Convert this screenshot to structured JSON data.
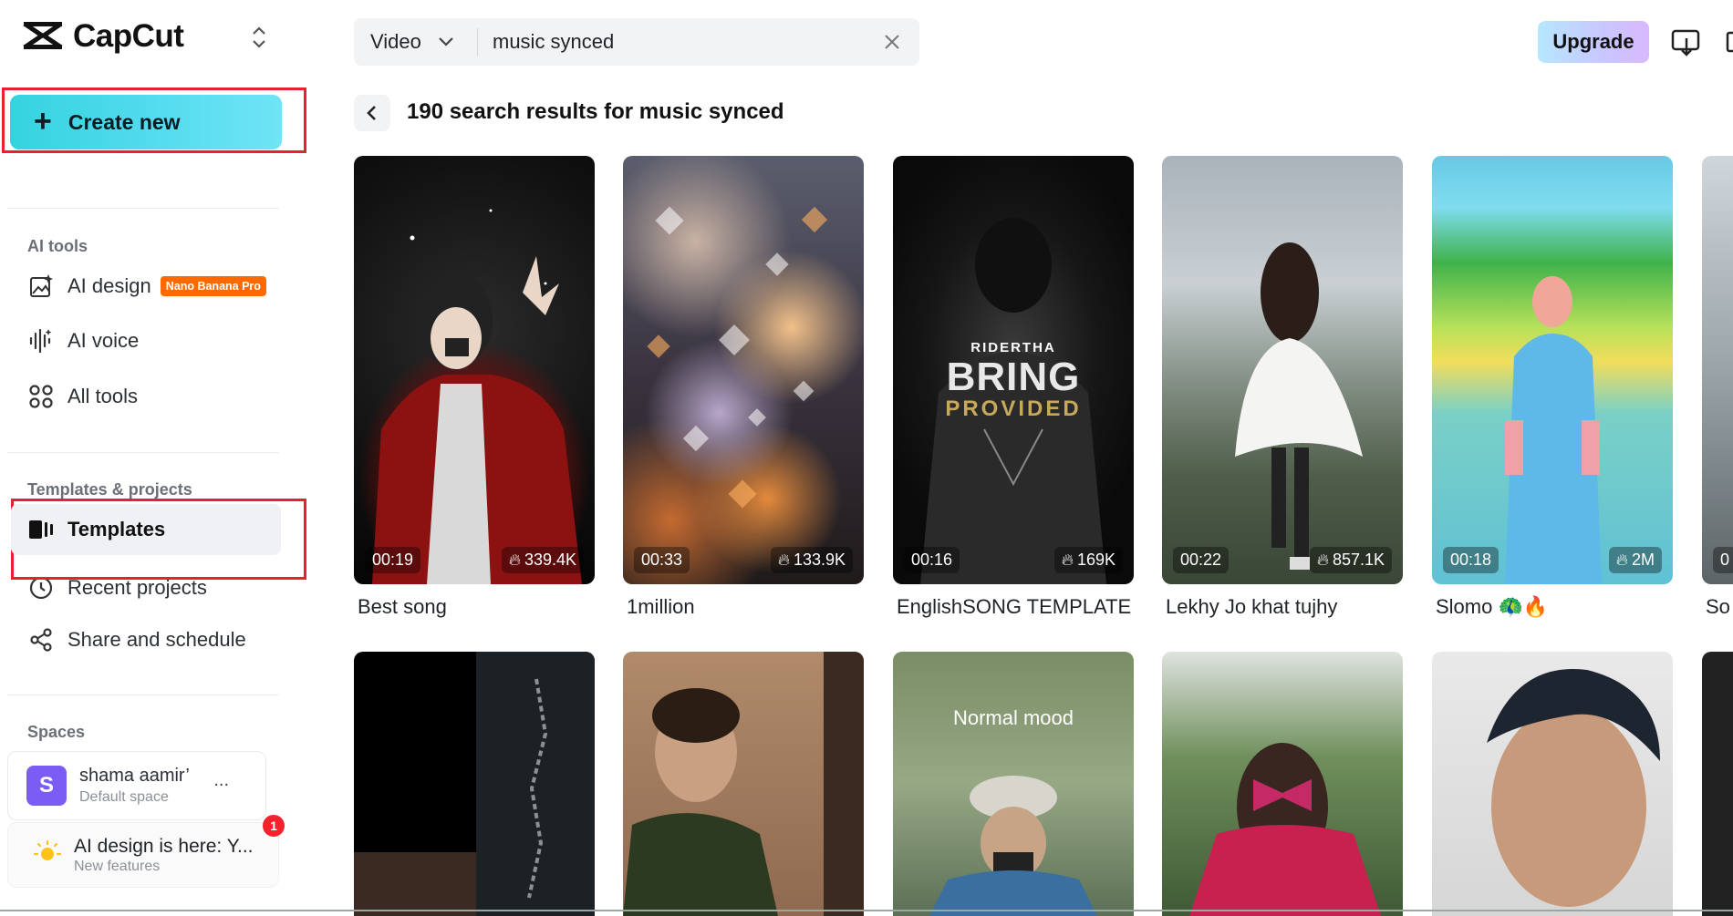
{
  "app": {
    "logo_text": "CapCut"
  },
  "sidebar": {
    "create_label": "Create new",
    "sections": {
      "ai_tools": "AI tools",
      "templates_projects": "Templates & projects",
      "spaces": "Spaces"
    },
    "ai_items": [
      {
        "label": "AI design",
        "icon": "ai-design-icon",
        "badge": "Nano Banana Pro"
      },
      {
        "label": "AI voice",
        "icon": "ai-voice-icon"
      },
      {
        "label": "All tools",
        "icon": "all-tools-icon"
      }
    ],
    "project_items": [
      {
        "label": "Templates",
        "icon": "templates-icon",
        "active": true
      },
      {
        "label": "Recent projects",
        "icon": "clock-icon"
      },
      {
        "label": "Share and schedule",
        "icon": "share-icon"
      }
    ],
    "space": {
      "avatar_letter": "S",
      "name": "shama aamir’",
      "more": "...",
      "subtitle": "Default space"
    },
    "notice": {
      "title": "AI design is here: Y...",
      "subtitle": "New features",
      "count": "1"
    }
  },
  "header": {
    "search_type": "Video",
    "search_value": "music synced",
    "upgrade_label": "Upgrade"
  },
  "results": {
    "title": "190 search results for music synced",
    "row1": [
      {
        "title": "Best song",
        "duration": "00:19",
        "views": "339.4K"
      },
      {
        "title": "1million",
        "duration": "00:33",
        "views": "133.9K"
      },
      {
        "title": "EnglishSONG TEMPLATE",
        "duration": "00:16",
        "views": "169K",
        "overlay_small": "RIDERTHA",
        "overlay_big": "BRING",
        "overlay_sub": "PROVIDED"
      },
      {
        "title": "Lekhy Jo khat tujhy",
        "duration": "00:22",
        "views": "857.1K"
      },
      {
        "title": "Slomo 🦚🔥",
        "duration": "00:18",
        "views": "2M"
      },
      {
        "title": "So",
        "duration": "0"
      }
    ],
    "row2_overlay": "Normal mood"
  },
  "colors": {
    "accent_cyan": "#35d3df",
    "highlight_red": "#e8202f",
    "space_purple": "#7b5cf5",
    "badge_orange": "#ff6a00"
  }
}
